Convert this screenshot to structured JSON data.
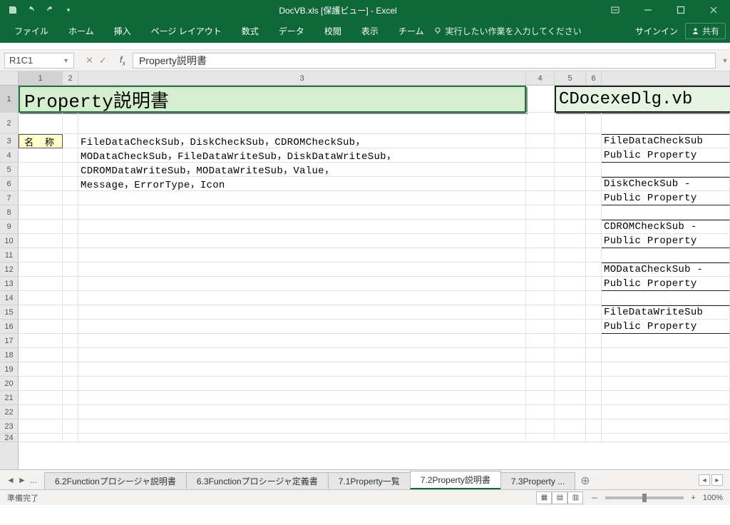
{
  "titlebar": {
    "title": "DocVB.xls [保護ビュー] - Excel"
  },
  "ribbon": {
    "tabs": [
      "ファイル",
      "ホーム",
      "挿入",
      "ページ レイアウト",
      "数式",
      "データ",
      "校閲",
      "表示",
      "チーム"
    ],
    "tellme": "実行したい作業を入力してください",
    "signin": "サインイン",
    "share": "共有"
  },
  "namebox": {
    "value": "R1C1"
  },
  "formula": {
    "value": "Property説明書"
  },
  "cols": [
    "1",
    "2",
    "3",
    "4",
    "5",
    "6"
  ],
  "cells": {
    "title_main": "Property説明書",
    "title_right": "CDocexeDlg.vb",
    "label_name": "名 称",
    "r3c3": "FileDataCheckSub，DiskCheckSub，CDROMCheckSub，",
    "r4c3": "MODataCheckSub，FileDataWriteSub，DiskDataWriteSub，",
    "r5c3": "CDROMDataWriteSub，MODataWriteSub，Value，",
    "r6c3": "Message，ErrorType，Icon",
    "r3r": "FileDataCheckSub",
    "r4r": "Public Property",
    "r6r": "DiskCheckSub - ",
    "r7r": "Public Property",
    "r9r": "CDROMCheckSub -",
    "r10r": "Public Property",
    "r12r": "MODataCheckSub -",
    "r13r": "Public Property",
    "r15r": "FileDataWriteSub",
    "r16r": "Public Property"
  },
  "sheets": {
    "items": [
      "6.2Functionプロシージャ説明書",
      "6.3Functionプロシージャ定義書",
      "7.1Property一覧",
      "7.2Property説明書",
      "7.3Property ..."
    ],
    "active_index": 3,
    "ellipsis": "..."
  },
  "status": {
    "ready": "準備完了",
    "zoom": "100%",
    "plus": "+",
    "minus": "－"
  }
}
